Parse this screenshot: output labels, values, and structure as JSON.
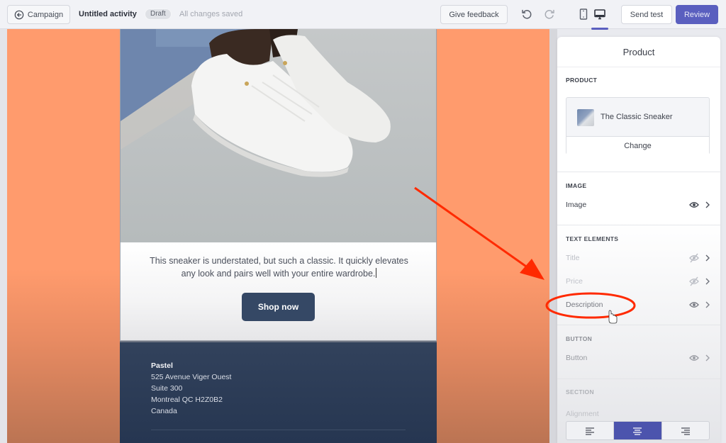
{
  "topbar": {
    "back_label": "Campaign",
    "activity_title": "Untitled activity",
    "status_badge": "Draft",
    "save_status": "All changes saved",
    "feedback_label": "Give feedback",
    "send_test_label": "Send test",
    "review_label": "Review",
    "preview_mode": "desktop"
  },
  "email": {
    "description": "This sneaker is understated, but such a classic. It quickly elevates any look and pairs well with your entire wardrobe.",
    "button_label": "Shop now",
    "footer": {
      "company": "Pastel",
      "address_lines": [
        "525 Avenue Viger Ouest",
        "Suite 300",
        "Montreal QC H2Z0B2",
        "Canada"
      ]
    }
  },
  "panel": {
    "title": "Product",
    "product_section_label": "PRODUCT",
    "product_name": "The Classic Sneaker",
    "change_label": "Change",
    "image_section_label": "IMAGE",
    "image_row_label": "Image",
    "text_section_label": "TEXT ELEMENTS",
    "text_rows": [
      {
        "label": "Title",
        "visible": false
      },
      {
        "label": "Price",
        "visible": false
      },
      {
        "label": "Description",
        "visible": true
      }
    ],
    "button_section_label": "BUTTON",
    "button_row_label": "Button",
    "section_label": "SECTION",
    "alignment_label": "Alignment",
    "alignment_options": [
      "left",
      "center",
      "right"
    ],
    "alignment_selected": "center"
  },
  "colors": {
    "accent": "#5a5fbf",
    "canvas_background": "#ff9b6d",
    "email_button": "#354865",
    "footer": "#2d3d57",
    "annotation": "#ff2a00"
  }
}
